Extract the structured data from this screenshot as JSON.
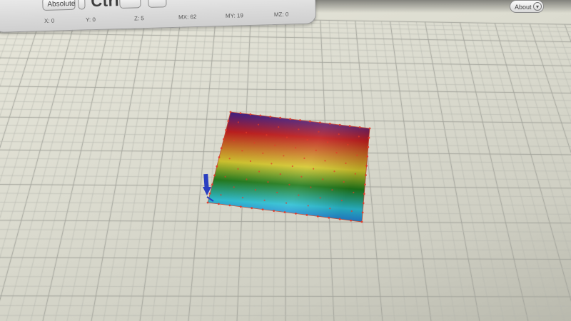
{
  "toolbar": {
    "absolute_label": "Absolute",
    "ctrl_label": "Ctrl",
    "readouts": {
      "x": "X: 0",
      "y": "Y: 0",
      "z": "Z: 5",
      "mx": "MX: 62",
      "my": "MY: 19",
      "mz": "MZ: 0"
    }
  },
  "about": {
    "label": "About",
    "chevron": "▾"
  },
  "surface": {
    "colormap": [
      "#3a1f8a",
      "#c01b1b",
      "#d4c72c",
      "#1f7a1a",
      "#2bbfd4",
      "#1e4fd6"
    ],
    "marker_color": "#e23a2a",
    "axis_color": "#2a3fc0"
  },
  "colors": {
    "grid_minor": "#b7b8b0",
    "grid_major": "#a2a39b"
  }
}
